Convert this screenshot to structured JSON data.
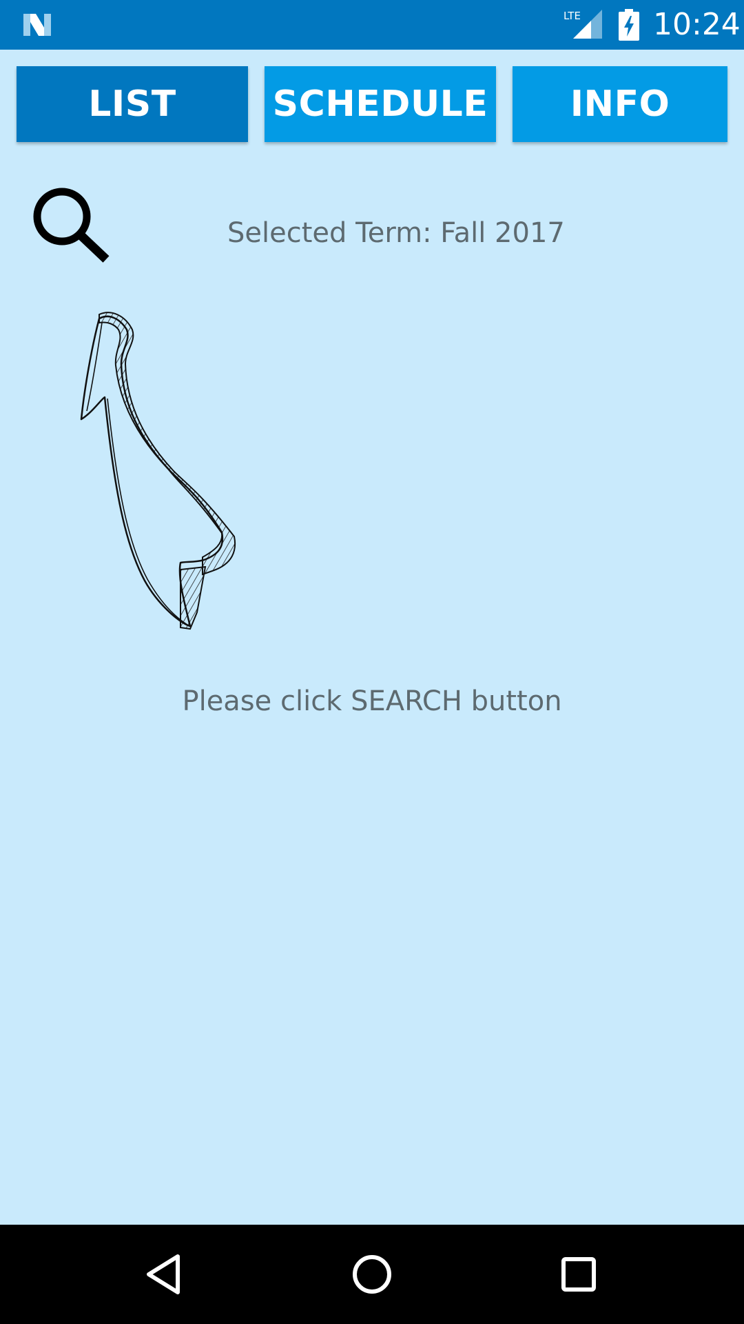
{
  "status_bar": {
    "network_label": "LTE",
    "time": "10:24",
    "background_color": "#0177bf",
    "icons": [
      "notification-n-icon",
      "lte-signal-icon",
      "battery-charging-icon"
    ]
  },
  "tabs": [
    {
      "label": "LIST",
      "selected": true,
      "color": "#0177bf"
    },
    {
      "label": "SCHEDULE",
      "selected": false,
      "color": "#039be5"
    },
    {
      "label": "INFO",
      "selected": false,
      "color": "#039be5"
    }
  ],
  "search": {
    "icon": "search-icon",
    "selected_term": "Selected Term: Fall 2017"
  },
  "hint": {
    "illustration": "hand-drawn-arrow-icon",
    "text": "Please click SEARCH button"
  },
  "nav_bar": {
    "icons": [
      "back-icon",
      "home-icon",
      "recents-icon"
    ]
  },
  "colors": {
    "page_background": "#c9eafc",
    "text_muted": "#5d6a70"
  }
}
